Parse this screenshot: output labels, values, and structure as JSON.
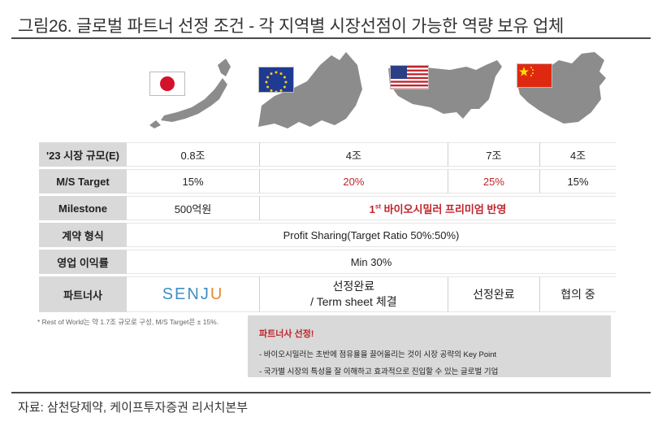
{
  "title": "그림26. 글로벌 파트너 선정 조건 - 각 지역별 시장선점이 가능한 역량 보유 업체",
  "regions": [
    {
      "name": "Japan",
      "flag_icon": "japan-flag-icon",
      "map_icon": "japan-map-icon"
    },
    {
      "name": "EU",
      "flag_icon": "eu-flag-icon",
      "map_icon": "europe-map-icon"
    },
    {
      "name": "US",
      "flag_icon": "us-flag-icon",
      "map_icon": "usa-map-icon"
    },
    {
      "name": "China",
      "flag_icon": "china-flag-icon",
      "map_icon": "china-map-icon"
    }
  ],
  "rows": {
    "market": {
      "label": "'23 시장 규모(E)",
      "values": [
        "0.8조",
        "4조",
        "7조",
        "4조"
      ]
    },
    "ms": {
      "label": "M/S Target",
      "values": [
        "15%",
        "20%",
        "25%",
        "15%"
      ]
    },
    "milestone": {
      "label": "Milestone",
      "first": "500억원",
      "merged_sup": "st",
      "merged_num": "1",
      "merged_rest": " 바이오시밀러 프리미엄 반영"
    },
    "contract": {
      "label": "계약 형식",
      "merged": "Profit Sharing(Target Ratio 50%:50%)"
    },
    "margin": {
      "label": "영업 이익률",
      "merged": "Min 30%"
    },
    "partner": {
      "label": "파트너사",
      "senju_a": "SENJ",
      "senju_b": "U",
      "values": [
        "선정완료",
        "/ Term sheet 체결",
        "선정완료",
        "협의 중"
      ]
    }
  },
  "footnote": "* Rest of World는 약 1.7조 규모로 구성, M/S Target은 ± 15%.",
  "callout": {
    "heading": "파트너사 선정!",
    "lines": [
      "- 바이오시밀러는 초반에 점유율을 끌어올리는 것이 시장 공략의 Key Point",
      "- 국가별 시장의 특성을 잘 이해하고 효과적으로 진입할 수 있는 글로벌 기업"
    ]
  },
  "source": "자료: 삼천당제약, 케이프투자증권 리서치본부",
  "colors": {
    "accent_red": "#c0232b",
    "label_gray": "#d9d9d9",
    "map_gray": "#8c8c8c"
  }
}
